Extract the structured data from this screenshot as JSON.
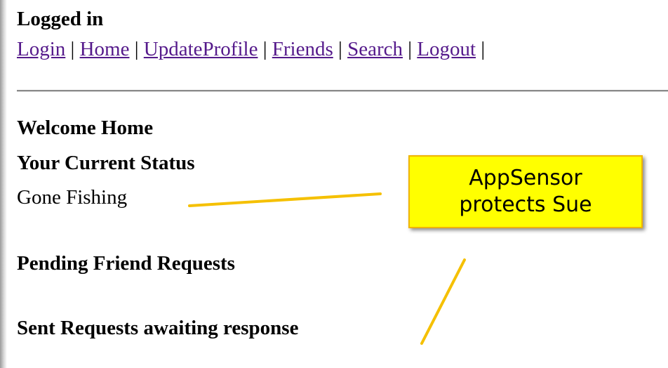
{
  "status_header": "Logged in",
  "nav": {
    "items": [
      {
        "label": "Login"
      },
      {
        "label": "Home"
      },
      {
        "label": "UpdateProfile"
      },
      {
        "label": "Friends"
      },
      {
        "label": "Search"
      },
      {
        "label": "Logout"
      }
    ],
    "separator": "|"
  },
  "content": {
    "welcome": "Welcome Home",
    "status_heading": "Your Current Status",
    "status_value": "Gone Fishing",
    "pending_heading": "Pending Friend Requests",
    "sent_heading": "Sent Requests awaiting response"
  },
  "callout": {
    "line1": "AppSensor",
    "line2": "protects Sue",
    "fill_color": "#ffff00",
    "border_color": "#f0b400",
    "pointer_color": "#f5c000"
  },
  "colors": {
    "visited_link": "#551a8b"
  }
}
